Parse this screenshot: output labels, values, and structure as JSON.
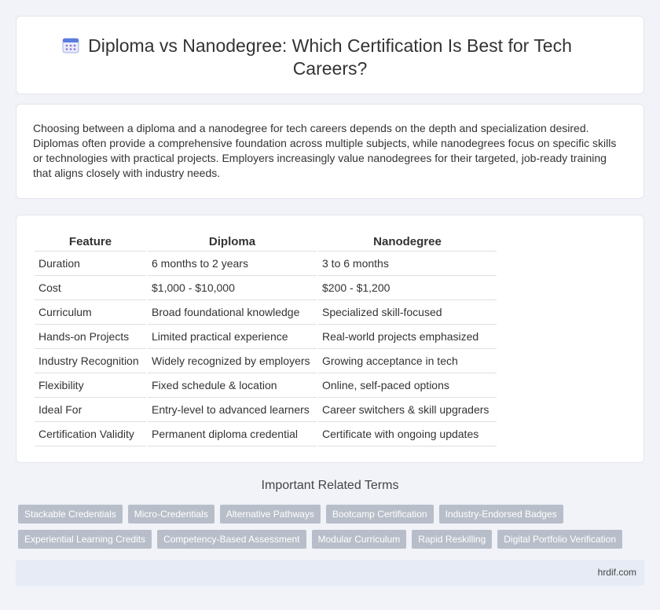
{
  "header": {
    "title": "Diploma vs Nanodegree: Which Certification Is Best for Tech Careers?",
    "icon": "calendar-icon",
    "accent_color": "#5b7ce0"
  },
  "intro": {
    "text": "Choosing between a diploma and a nanodegree for tech careers depends on the depth and specialization desired. Diplomas often provide a comprehensive foundation across multiple subjects, while nanodegrees focus on specific skills or technologies with practical projects. Employers increasingly value nanodegrees for their targeted, job-ready training that aligns closely with industry needs."
  },
  "table": {
    "headers": [
      "Feature",
      "Diploma",
      "Nanodegree"
    ],
    "rows": [
      [
        "Duration",
        "6 months to 2 years",
        "3 to 6 months"
      ],
      [
        "Cost",
        "$1,000 - $10,000",
        "$200 - $1,200"
      ],
      [
        "Curriculum",
        "Broad foundational knowledge",
        "Specialized skill-focused"
      ],
      [
        "Hands-on Projects",
        "Limited practical experience",
        "Real-world projects emphasized"
      ],
      [
        "Industry Recognition",
        "Widely recognized by employers",
        "Growing acceptance in tech"
      ],
      [
        "Flexibility",
        "Fixed schedule & location",
        "Online, self-paced options"
      ],
      [
        "Ideal For",
        "Entry-level to advanced learners",
        "Career switchers & skill upgraders"
      ],
      [
        "Certification Validity",
        "Permanent diploma credential",
        "Certificate with ongoing updates"
      ]
    ]
  },
  "related": {
    "title": "Important Related Terms",
    "row1": [
      "Stackable Credentials",
      "Micro-Credentials",
      "Alternative Pathways",
      "Bootcamp Certification",
      "Industry-Endorsed Badges"
    ],
    "row2": [
      "Experiential Learning Credits",
      "Competency-Based Assessment",
      "Modular Curriculum",
      "Rapid Reskilling",
      "Digital Portfolio Verification"
    ]
  },
  "footer": {
    "site": "hrdif.com"
  }
}
